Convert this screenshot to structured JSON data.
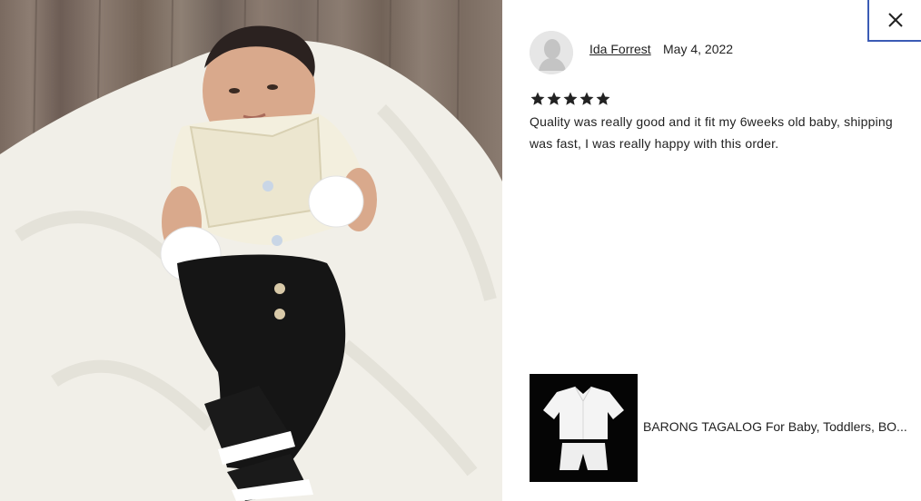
{
  "review": {
    "reviewer_name": "Ida Forrest",
    "date": "May 4, 2022",
    "rating": 5,
    "rating_max": 5,
    "text": "Quality was really good and it fit my 6weeks old baby, shipping was fast, I was really happy with this order."
  },
  "product": {
    "title": "BARONG TAGALOG For Baby, Toddlers, BO..."
  },
  "icons": {
    "close": "close-icon",
    "star": "star-icon",
    "avatar": "default-avatar-icon"
  },
  "colors": {
    "close_border": "#3b5bb5",
    "star": "#222222",
    "text": "#222222"
  }
}
